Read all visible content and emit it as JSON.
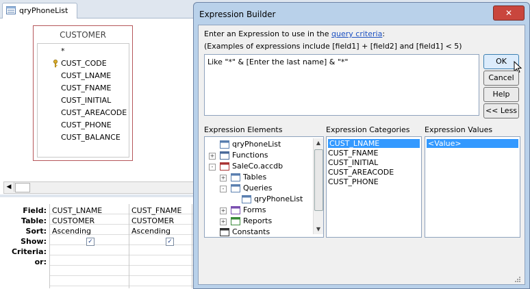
{
  "background": {
    "tab_label": "qryPhoneList",
    "table": {
      "title": "CUSTOMER",
      "fields": [
        "*",
        "CUST_CODE",
        "CUST_LNAME",
        "CUST_FNAME",
        "CUST_INITIAL",
        "CUST_AREACODE",
        "CUST_PHONE",
        "CUST_BALANCE"
      ]
    },
    "grid": {
      "row_labels": [
        "Field:",
        "Table:",
        "Sort:",
        "Show:",
        "Criteria:",
        "or:"
      ],
      "columns": [
        {
          "field": "CUST_LNAME",
          "table": "CUSTOMER",
          "sort": "Ascending",
          "show": true
        },
        {
          "field": "CUST_FNAME",
          "table": "CUSTOMER",
          "sort": "Ascending",
          "show": true
        }
      ]
    }
  },
  "dialog": {
    "title": "Expression Builder",
    "close_label": "✕",
    "instruction_prefix": "Enter an Expression to use in the ",
    "instruction_link": "query criteria",
    "instruction_suffix": ":",
    "examples": "(Examples of expressions include [field1] + [field2] and [field1] < 5)",
    "expression": "Like \"*\" & [Enter the last name] & \"*\"",
    "buttons": {
      "ok": "OK",
      "cancel": "Cancel",
      "help": "Help",
      "less": "<< Less"
    },
    "elements_label": "Expression Elements",
    "categories_label": "Expression Categories",
    "values_label": "Expression Values",
    "elements": [
      {
        "label": "qryPhoneList",
        "icon": "query-icon",
        "expander": ""
      },
      {
        "label": "Functions",
        "icon": "function-icon",
        "expander": "+"
      },
      {
        "label": "SaleCo.accdb",
        "icon": "database-icon",
        "expander": "-"
      },
      {
        "label": "Tables",
        "icon": "table-icon",
        "expander": "+"
      },
      {
        "label": "Queries",
        "icon": "query-icon",
        "expander": "-"
      },
      {
        "label": "qryPhoneList",
        "icon": "query-icon",
        "expander": ""
      },
      {
        "label": "Forms",
        "icon": "form-icon",
        "expander": "+"
      },
      {
        "label": "Reports",
        "icon": "report-icon",
        "expander": "+"
      },
      {
        "label": "Constants",
        "icon": "constants-icon",
        "expander": ""
      }
    ],
    "categories": [
      "CUST_LNAME",
      "CUST_FNAME",
      "CUST_INITIAL",
      "CUST_AREACODE",
      "CUST_PHONE"
    ],
    "selected_category": "CUST_LNAME",
    "values": [
      "<Value>"
    ],
    "selected_value": "<Value>"
  },
  "colors": {
    "selection": "#3399ff",
    "dialog_frame": "#b9d1ea",
    "close_button": "#c9463d",
    "link": "#1a4fc1"
  }
}
